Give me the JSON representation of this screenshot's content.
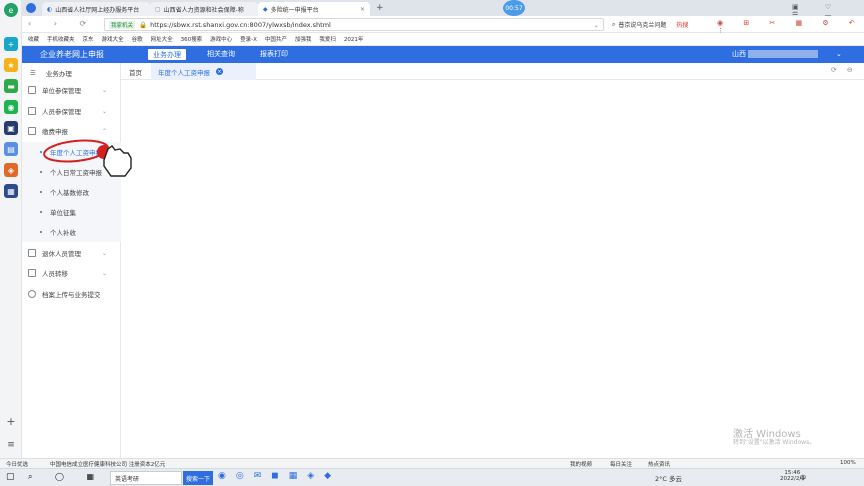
{
  "browser": {
    "tabs": [
      {
        "title": "山西省人社厅网上经办服务平台",
        "active": false
      },
      {
        "title": "山西省人力资源和社会保障-称",
        "active": false
      },
      {
        "title": "多险统一申报平台",
        "active": true
      }
    ],
    "badge": "00:57",
    "secure_badge": "我家机关",
    "url": "https://sbwx.rst.shanxi.gov.cn:8007/ylwxsb/index.shtml",
    "search_placeholder": "普京说乌克兰问题",
    "hot_label": "热搜"
  },
  "bookmarks": [
    "收藏",
    "手机收藏夹",
    "京东",
    "游戏大全",
    "谷歌",
    "网址大全",
    "360搜索",
    "游戏中心",
    "登录-X",
    "中国共产",
    "加强我",
    "我爱扫",
    "2021年"
  ],
  "app": {
    "title": "企业养老网上申报",
    "nav": [
      "业务办理",
      "相关查询",
      "报表打印"
    ],
    "active_nav": "业务办理",
    "user": "山西"
  },
  "sidebar": {
    "header": "业务办理",
    "items": [
      {
        "label": "单位参保管理",
        "expandable": true
      },
      {
        "label": "人员参保管理",
        "expandable": true
      },
      {
        "label": "缴费申报",
        "expandable": true
      }
    ],
    "subitems": [
      "年度个人工资申报",
      "个人日常工资申报",
      "个人基数修改",
      "单位征集",
      "个人补收"
    ],
    "items2": [
      {
        "label": "退休人员管理",
        "expandable": true
      },
      {
        "label": "人员转移",
        "expandable": true
      },
      {
        "label": "档案上传与业务提交",
        "expandable": false
      }
    ]
  },
  "content_tabs": {
    "home": "首页",
    "active": "年度个人工资申报"
  },
  "watermark": {
    "line1": "激活 Windows",
    "line2": "转到\"设置\"以激活 Windows。"
  },
  "status_bar": {
    "left": "今日优选",
    "ad": "中国电信成立医疗健康科技公司 注册资本2亿元",
    "right": [
      "我的视频",
      "每日关注",
      "热点资讯"
    ],
    "zoom": "100%"
  },
  "taskbar": {
    "search_app": "英语考研",
    "search_btn": "搜索一下",
    "weather": "2°C 多云",
    "time": "15:46",
    "date": "2022/2/9",
    "ime": "中"
  },
  "colors": {
    "primary": "#2f6ee0",
    "annotation": "#d32020"
  }
}
